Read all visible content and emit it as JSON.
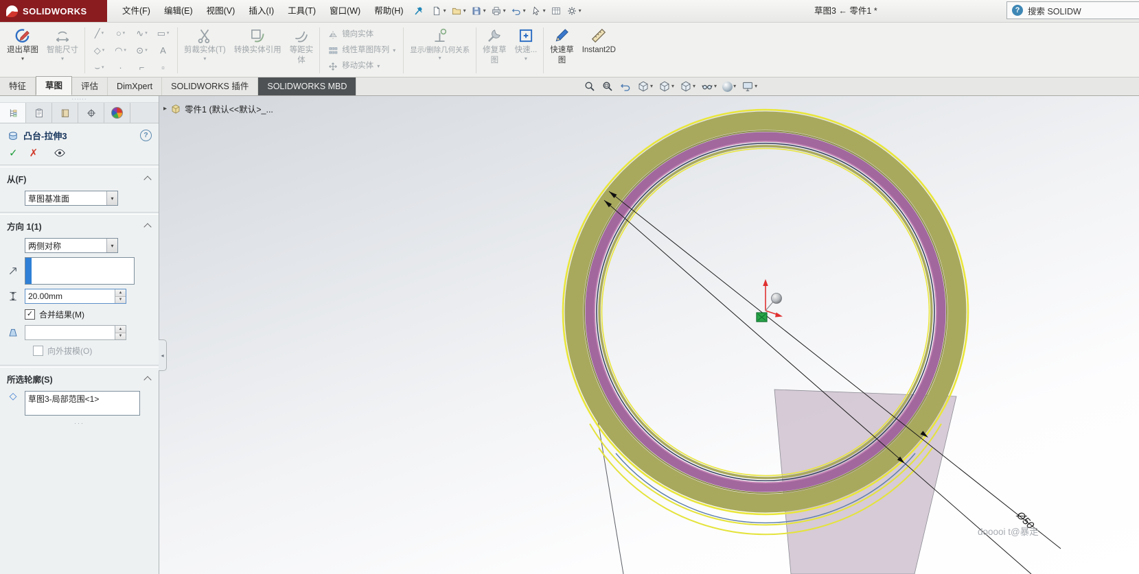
{
  "colors": {
    "logo_background": "#8a1b1f",
    "accent_blue": "#2f80d6",
    "preview_ring_olive": "#a9a95e",
    "body_ring_purple": "#a2689e",
    "sketch_yellow": "#e9e63a",
    "edge_navy": "#3b4260",
    "origin_green": "#29a449",
    "triad_red": "#e03030"
  },
  "glyphs": {
    "caret": "▾",
    "check": "✓",
    "cross": "✗",
    "help": "?",
    "dots": "······",
    "ellipsis": "···",
    "collapse_arrow": "▸",
    "diamond": "◇",
    "spin_up": "▲",
    "spin_down": "▼",
    "handle_arrow": "◂"
  },
  "titlebar": {
    "logo_text": "SOLIDWORKS",
    "menus": [
      "文件(F)",
      "编辑(E)",
      "视图(V)",
      "插入(I)",
      "工具(T)",
      "窗口(W)",
      "帮助(H)"
    ],
    "doc_title": "草图3 ← 零件1 *",
    "search_text": "搜索 SOLIDW"
  },
  "ribbon": {
    "exit_sketch": "退出草图",
    "smart_dimension": "智能尺寸",
    "sketch_glyphs": [
      "╱",
      "○",
      "∿",
      "▭",
      "◇",
      "◠",
      "⊙",
      "A",
      "⌣",
      "·",
      "⌐",
      "▫"
    ],
    "trim": "剪裁实体(T)",
    "convert_entities": "转换实体引用",
    "offset_line1": "等距实",
    "offset_line2": "体",
    "mirror": "镜向实体",
    "linear_pattern": "线性草图阵列",
    "move": "移动实体",
    "display_delete_relations": "显示/删除几何关系",
    "repair_line1": "修复草",
    "repair_line2": "图",
    "rapid_snap": "快速...",
    "rapid_sketch_line1": "快速草",
    "rapid_sketch_line2": "图",
    "instant2d": "Instant2D"
  },
  "tabs": [
    "特征",
    "草图",
    "评估",
    "DimXpert",
    "SOLIDWORKS 插件",
    "SOLIDWORKS MBD"
  ],
  "active_tab": "草图",
  "breadcrumb": "零件1 (默认<<默认>_...",
  "property_manager": {
    "title": "凸台-拉伸3",
    "from_header": "从(F)",
    "from_plane": "草图基准面",
    "dir1_header": "方向 1(1)",
    "dir1_end_condition": "两侧对称",
    "depth_value": "20.00mm",
    "merge_result_label": "合并结果(M)",
    "draft_outward_label": "向外拔模(O)",
    "contours_header": "所选轮廓(S)",
    "contour_item": "草图3-局部范围<1>"
  },
  "viewport": {
    "dimension_label": "Ø50",
    "watermark": "dooooi t@暴走"
  }
}
